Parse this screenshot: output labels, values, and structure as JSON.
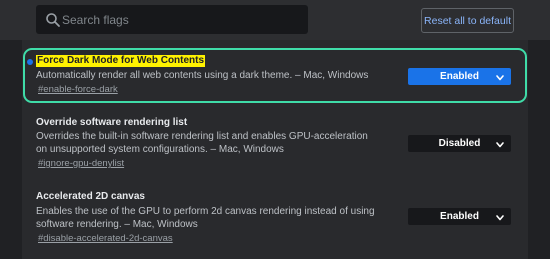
{
  "search": {
    "placeholder": "Search flags",
    "icon": "search-icon"
  },
  "toolbar": {
    "reset_label": "Reset all to default"
  },
  "colors": {
    "background": "#202124",
    "panel": "#292a2d",
    "accent_blue": "#1a73e8",
    "highlight_border": "#3fdca8",
    "highlight_text": "#fff200"
  },
  "flags": [
    {
      "title": "Force Dark Mode for Web Contents",
      "description": "Automatically render all web contents using a dark theme. – Mac, Windows",
      "link": "#enable-force-dark",
      "selected": "Enabled",
      "modified": true
    },
    {
      "title": "Override software rendering list",
      "description": "Overrides the built-in software rendering list and enables GPU-acceleration on unsupported system configurations. – Mac, Windows",
      "link": "#ignore-gpu-denylist",
      "selected": "Disabled",
      "modified": false
    },
    {
      "title": "Accelerated 2D canvas",
      "description": "Enables the use of the GPU to perform 2d canvas rendering instead of using software rendering. – Mac, Windows",
      "link": "#disable-accelerated-2d-canvas",
      "selected": "Enabled",
      "modified": false
    }
  ]
}
